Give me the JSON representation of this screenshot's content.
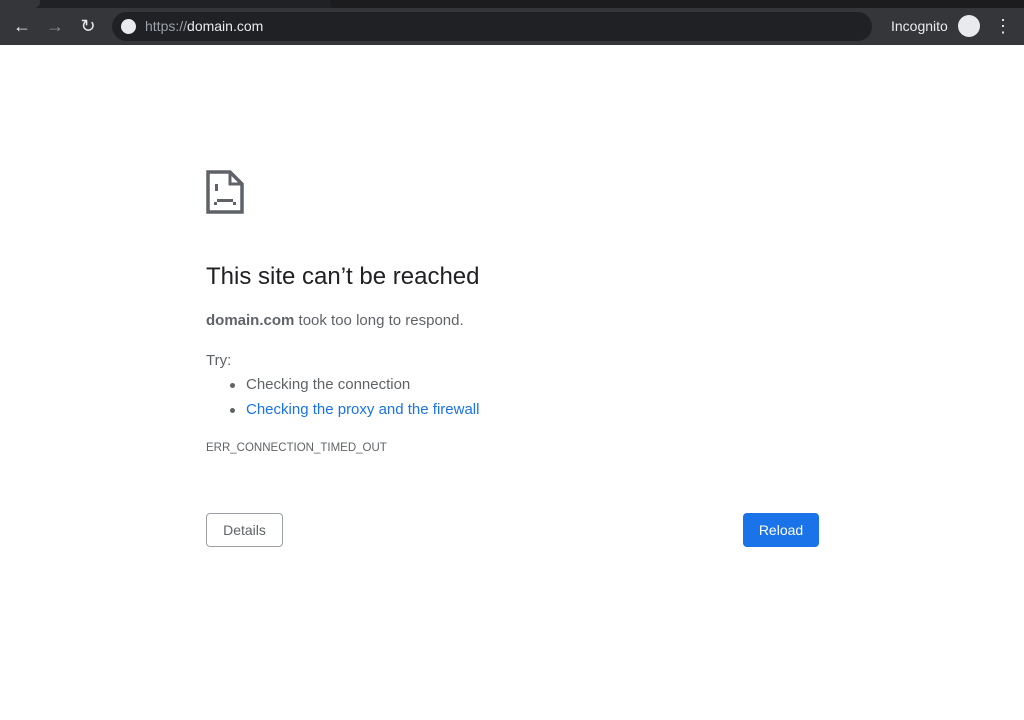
{
  "browser": {
    "url_scheme": "https://",
    "url_host": "domain.com",
    "incognito_label": "Incognito",
    "icons": [
      "back-arrow-icon",
      "forward-arrow-icon",
      "reload-icon",
      "globe-icon",
      "incognito-icon",
      "more-vert-icon"
    ]
  },
  "error": {
    "icon": "sad-document-icon",
    "title": "This site can’t be reached",
    "host": "domain.com",
    "message": " took too long to respond.",
    "try_label": "Try:",
    "suggestions": [
      "Checking the connection",
      "Checking the proxy and the firewall"
    ],
    "code": "ERR_CONNECTION_TIMED_OUT",
    "details_label": "Details",
    "reload_label": "Reload"
  },
  "colors": {
    "accent": "#1a73e8",
    "toolbar": "#35363a",
    "text": "#5f6368"
  }
}
